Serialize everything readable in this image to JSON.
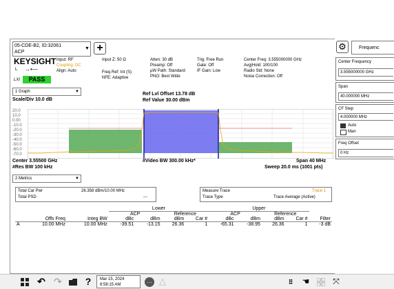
{
  "instrument": {
    "file_line1": "05-CDE-B2, ID:32061",
    "file_line2": "ACP",
    "brand": "KEYSIGHT",
    "input_label": "Input: RF",
    "coupling": "Coupling: DC",
    "align": "Align: Auto",
    "input_z": "Input Z: 50 Ω",
    "freq_ref": "Freq Ref: Int (S)",
    "nfe": "NFE: Adaptive",
    "atten": "Atten: 30 dB",
    "preamp": "Preamp: Off",
    "uw_path": "µW Path: Standard",
    "pno": "PNO: Best Wide",
    "trig": "Trig: Free Run",
    "gate": "Gate: Off",
    "if_gain": "IF Gain: Low",
    "center_freq": "Center Freq: 3.555000000 GHz",
    "avg_hold": "Avg|Hold: 100/100",
    "radio_std": "Radio Std: None",
    "noise_corr": "Noise Correction: Off",
    "pass_label": "PASS",
    "mode_letter": "L",
    "lxi": "LXI"
  },
  "graph": {
    "view_select": "1 Graph",
    "scale": "Scale/Div 10.0 dB",
    "ref_offset": "Ref Lvl Offset 13.78 dB",
    "ref_value": "Ref Value 30.00 dBm",
    "y_ticks": [
      "20.0",
      "10.0",
      "0.00",
      "-10.0",
      "-20.0",
      "-30.0",
      "-40.0",
      "-50.0",
      "-60.0",
      "-70.0"
    ],
    "center": "Center 3.55500 GHz",
    "res_bw": "#Res BW 100 kHz",
    "video_bw": "#Video BW 300.00 kHz*",
    "span": "Span 40 MHz",
    "sweep": "Sweep 20.0 ms (1001 pts)"
  },
  "metrics": {
    "select": "2 Metrics",
    "total_car_pwr_label": "Total Car Pwr",
    "total_car_pwr_value": "26.358 dBm/10.00 MHz",
    "total_psd_label": "Total PSD",
    "total_psd_value": "---",
    "measure_trace_label": "Measure Trace",
    "measure_trace_value": "Trace 1",
    "trace_type_label": "Trace Type",
    "trace_type_value": "Trace Average (Active)"
  },
  "table": {
    "group_lower": "Lower",
    "group_upper": "Upper",
    "sub_acp": "ACP",
    "sub_reference": "Reference",
    "headers": [
      "",
      "Offs Freq",
      "Integ BW",
      "dBc",
      "dBm",
      "dBm",
      "Car #",
      "dBc",
      "dBm",
      "dBm",
      "Car #",
      "Filter"
    ],
    "row": [
      "A",
      "10.00 MHz",
      "10.00 MHz",
      "-39.51",
      "-13.15",
      "26.36",
      "1",
      "-65.31",
      "-38.95",
      "26.36",
      "1",
      "-3 dB"
    ]
  },
  "right_panel": {
    "tab_label": "Frequenc",
    "center_frequency_label": "Center Frequency",
    "center_frequency_value": "3.555000000 GHz",
    "span_label": "Span",
    "span_value": "40.000000 MHz",
    "cf_step_label": "CF Step",
    "cf_step_value": "4.000000 MHz",
    "auto_label": "Auto",
    "man_label": "Man",
    "freq_offset_label": "Freq Offset",
    "freq_offset_value": "0 Hz"
  },
  "taskbar": {
    "date": "Mar 15, 2024",
    "time": "8:58:15 AM"
  },
  "colors": {
    "plot_bg": "#ffffff",
    "main_channel": "#6f6ff0",
    "adjacent_channel": "#5fae5f",
    "trace": "#f0a400",
    "limit_line": "#e07070",
    "pass_bg": "#2fd02f"
  }
}
